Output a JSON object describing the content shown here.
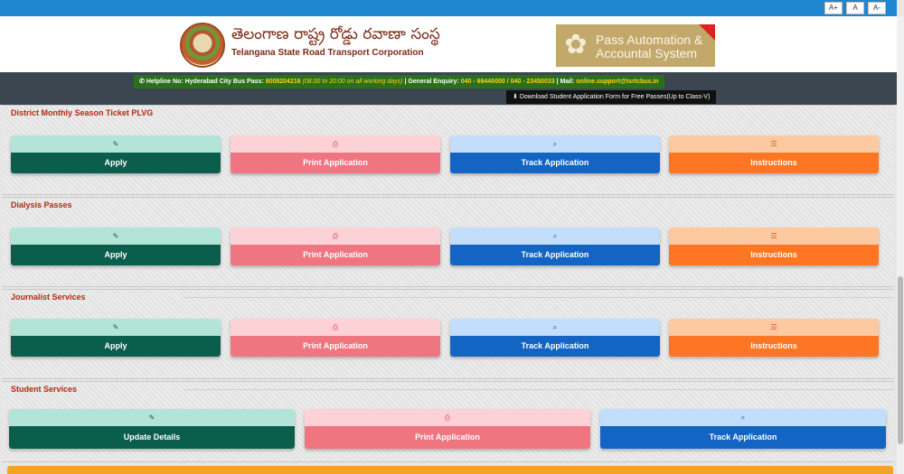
{
  "font_buttons": [
    "A+",
    "A",
    "A-"
  ],
  "header": {
    "title_telugu": "తెలంగాణ రాష్ట్ర రోడ్డు రవాణా సంస్థ",
    "title_english": "Telangana State Road Transport Corporation",
    "pas_line1": "Pass Automation &",
    "pas_line2": "Accountal System"
  },
  "helpline": {
    "label": "Helpline No: Hyderabad City Bus Pass:",
    "number": "8008204216",
    "hours": "(08:00 to 20:00 on all working days)",
    "enquiry_label": "| General Enquiry:",
    "enquiry_numbers": "040 - 69440000 / 040 - 23450033",
    "mail_label": "| Mail:",
    "mail": "online.support@tsrtcbus.in"
  },
  "download_label": "Download Student Application Form for Free Passes(Up to Class-V)",
  "sections": [
    {
      "title": "District Monthly Season Ticket PLVG",
      "apply": "Apply",
      "print": "Print Application",
      "track": "Track Application",
      "instructions": "Instructions"
    },
    {
      "title": "Dialysis Passes",
      "apply": "Apply",
      "print": "Print Application",
      "track": "Track Application",
      "instructions": "Instructions"
    },
    {
      "title": "Journalist Services",
      "apply": "Apply",
      "print": "Print Application",
      "track": "Track Application",
      "instructions": "Instructions"
    },
    {
      "title": "Student Services",
      "update": "Update Details",
      "print": "Print Application",
      "track": "Track Application"
    }
  ],
  "icons": {
    "apply": "edit-icon",
    "print": "print-icon",
    "track": "search-icon",
    "instructions": "list-icon"
  },
  "colors": {
    "top_bar": "#1e86cf",
    "apply": "#0c5e4c",
    "print": "#ef7580",
    "track": "#1464c3",
    "instructions": "#fd7623",
    "section_title": "#b32a12"
  }
}
